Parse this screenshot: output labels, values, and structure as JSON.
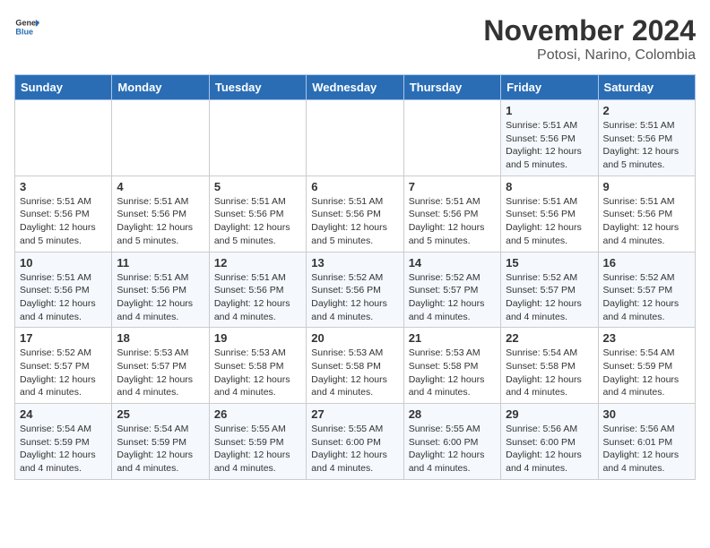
{
  "header": {
    "logo": {
      "general": "General",
      "blue": "Blue"
    },
    "title": "November 2024",
    "location": "Potosi, Narino, Colombia"
  },
  "weekdays": [
    "Sunday",
    "Monday",
    "Tuesday",
    "Wednesday",
    "Thursday",
    "Friday",
    "Saturday"
  ],
  "weeks": [
    [
      {
        "day": "",
        "info": ""
      },
      {
        "day": "",
        "info": ""
      },
      {
        "day": "",
        "info": ""
      },
      {
        "day": "",
        "info": ""
      },
      {
        "day": "",
        "info": ""
      },
      {
        "day": "1",
        "info": "Sunrise: 5:51 AM\nSunset: 5:56 PM\nDaylight: 12 hours and 5 minutes."
      },
      {
        "day": "2",
        "info": "Sunrise: 5:51 AM\nSunset: 5:56 PM\nDaylight: 12 hours and 5 minutes."
      }
    ],
    [
      {
        "day": "3",
        "info": "Sunrise: 5:51 AM\nSunset: 5:56 PM\nDaylight: 12 hours and 5 minutes."
      },
      {
        "day": "4",
        "info": "Sunrise: 5:51 AM\nSunset: 5:56 PM\nDaylight: 12 hours and 5 minutes."
      },
      {
        "day": "5",
        "info": "Sunrise: 5:51 AM\nSunset: 5:56 PM\nDaylight: 12 hours and 5 minutes."
      },
      {
        "day": "6",
        "info": "Sunrise: 5:51 AM\nSunset: 5:56 PM\nDaylight: 12 hours and 5 minutes."
      },
      {
        "day": "7",
        "info": "Sunrise: 5:51 AM\nSunset: 5:56 PM\nDaylight: 12 hours and 5 minutes."
      },
      {
        "day": "8",
        "info": "Sunrise: 5:51 AM\nSunset: 5:56 PM\nDaylight: 12 hours and 5 minutes."
      },
      {
        "day": "9",
        "info": "Sunrise: 5:51 AM\nSunset: 5:56 PM\nDaylight: 12 hours and 4 minutes."
      }
    ],
    [
      {
        "day": "10",
        "info": "Sunrise: 5:51 AM\nSunset: 5:56 PM\nDaylight: 12 hours and 4 minutes."
      },
      {
        "day": "11",
        "info": "Sunrise: 5:51 AM\nSunset: 5:56 PM\nDaylight: 12 hours and 4 minutes."
      },
      {
        "day": "12",
        "info": "Sunrise: 5:51 AM\nSunset: 5:56 PM\nDaylight: 12 hours and 4 minutes."
      },
      {
        "day": "13",
        "info": "Sunrise: 5:52 AM\nSunset: 5:56 PM\nDaylight: 12 hours and 4 minutes."
      },
      {
        "day": "14",
        "info": "Sunrise: 5:52 AM\nSunset: 5:57 PM\nDaylight: 12 hours and 4 minutes."
      },
      {
        "day": "15",
        "info": "Sunrise: 5:52 AM\nSunset: 5:57 PM\nDaylight: 12 hours and 4 minutes."
      },
      {
        "day": "16",
        "info": "Sunrise: 5:52 AM\nSunset: 5:57 PM\nDaylight: 12 hours and 4 minutes."
      }
    ],
    [
      {
        "day": "17",
        "info": "Sunrise: 5:52 AM\nSunset: 5:57 PM\nDaylight: 12 hours and 4 minutes."
      },
      {
        "day": "18",
        "info": "Sunrise: 5:53 AM\nSunset: 5:57 PM\nDaylight: 12 hours and 4 minutes."
      },
      {
        "day": "19",
        "info": "Sunrise: 5:53 AM\nSunset: 5:58 PM\nDaylight: 12 hours and 4 minutes."
      },
      {
        "day": "20",
        "info": "Sunrise: 5:53 AM\nSunset: 5:58 PM\nDaylight: 12 hours and 4 minutes."
      },
      {
        "day": "21",
        "info": "Sunrise: 5:53 AM\nSunset: 5:58 PM\nDaylight: 12 hours and 4 minutes."
      },
      {
        "day": "22",
        "info": "Sunrise: 5:54 AM\nSunset: 5:58 PM\nDaylight: 12 hours and 4 minutes."
      },
      {
        "day": "23",
        "info": "Sunrise: 5:54 AM\nSunset: 5:59 PM\nDaylight: 12 hours and 4 minutes."
      }
    ],
    [
      {
        "day": "24",
        "info": "Sunrise: 5:54 AM\nSunset: 5:59 PM\nDaylight: 12 hours and 4 minutes."
      },
      {
        "day": "25",
        "info": "Sunrise: 5:54 AM\nSunset: 5:59 PM\nDaylight: 12 hours and 4 minutes."
      },
      {
        "day": "26",
        "info": "Sunrise: 5:55 AM\nSunset: 5:59 PM\nDaylight: 12 hours and 4 minutes."
      },
      {
        "day": "27",
        "info": "Sunrise: 5:55 AM\nSunset: 6:00 PM\nDaylight: 12 hours and 4 minutes."
      },
      {
        "day": "28",
        "info": "Sunrise: 5:55 AM\nSunset: 6:00 PM\nDaylight: 12 hours and 4 minutes."
      },
      {
        "day": "29",
        "info": "Sunrise: 5:56 AM\nSunset: 6:00 PM\nDaylight: 12 hours and 4 minutes."
      },
      {
        "day": "30",
        "info": "Sunrise: 5:56 AM\nSunset: 6:01 PM\nDaylight: 12 hours and 4 minutes."
      }
    ]
  ]
}
